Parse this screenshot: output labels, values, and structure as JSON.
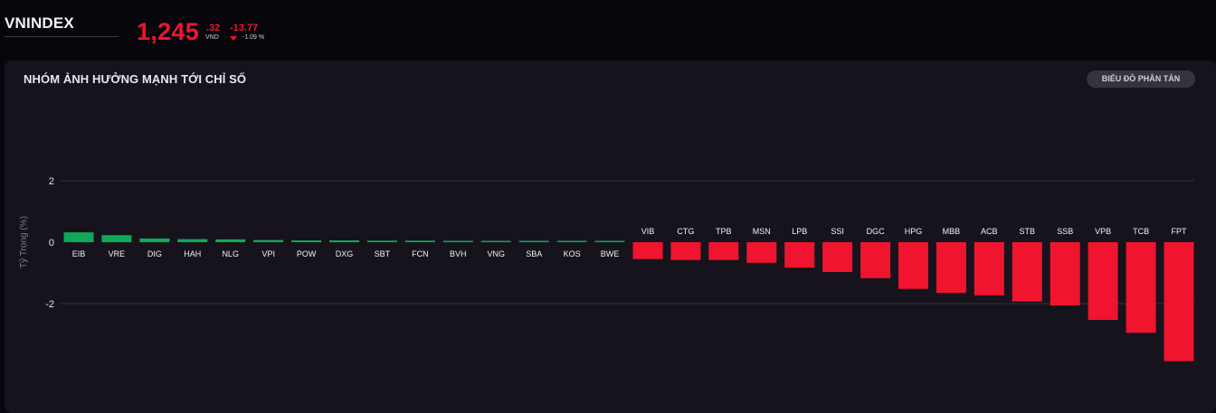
{
  "header": {
    "index_name": "VNINDEX",
    "price_main": "1,245",
    "price_decimal": ".32",
    "price_unit": "VND",
    "change": "-13.77",
    "change_pct": "-1.09 %",
    "colors": {
      "down": "#f0142f"
    },
    "icons": {
      "change_direction": "caret-down-icon"
    }
  },
  "panel": {
    "title": "NHÓM ẢNH HƯỞNG MẠNH TỚI CHỈ SỐ",
    "scatter_button_label": "BIỂU ĐỒ PHÂN TÁN"
  },
  "chart_data": {
    "type": "bar",
    "ylabel": "Tỷ Trọng (%)",
    "xlabel": "",
    "ylim": [
      -3.9,
      2
    ],
    "yticks": [
      {
        "value": 2,
        "label": "2"
      },
      {
        "value": 0,
        "label": "0"
      },
      {
        "value": -2,
        "label": "-2"
      }
    ],
    "grid": true,
    "colors": {
      "positive": "#0fa958",
      "negative": "#f0142f"
    },
    "categories": [
      "EIB",
      "VRE",
      "DIG",
      "HAH",
      "NLG",
      "VPI",
      "POW",
      "DXG",
      "SBT",
      "FCN",
      "BVH",
      "VNG",
      "SBA",
      "KOS",
      "BWE",
      "VIB",
      "CTG",
      "TPB",
      "MSN",
      "LPB",
      "SSI",
      "DGC",
      "HPG",
      "MBB",
      "ACB",
      "STB",
      "SSB",
      "VPB",
      "TCB",
      "FPT"
    ],
    "values": [
      0.32,
      0.23,
      0.12,
      0.1,
      0.09,
      0.07,
      0.06,
      0.06,
      0.05,
      0.05,
      0.04,
      0.04,
      0.04,
      0.04,
      0.04,
      -0.55,
      -0.58,
      -0.58,
      -0.67,
      -0.83,
      -0.97,
      -1.17,
      -1.52,
      -1.65,
      -1.73,
      -1.93,
      -2.06,
      -2.53,
      -2.95,
      -3.87
    ]
  }
}
